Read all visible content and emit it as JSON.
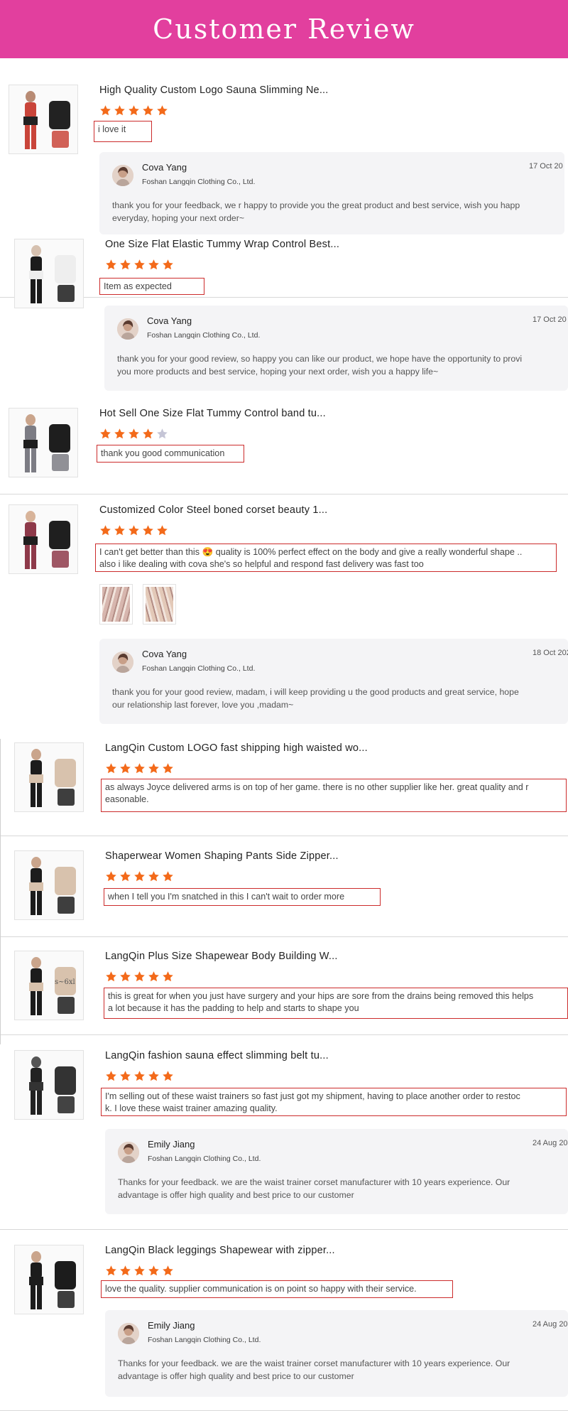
{
  "header": {
    "title": "Customer Review"
  },
  "colors": {
    "header_bg": "#e23f9e",
    "star_filled": "#f36a1a",
    "star_empty": "#c5c5d6",
    "comment_border": "#cc2b2b"
  },
  "reviews": [
    {
      "title": "High Quality Custom Logo Sauna Slimming Ne...",
      "rating": 5,
      "comment": [
        "i love it"
      ],
      "reply": {
        "name": "Cova Yang",
        "company": "Foshan Langqin Clothing Co., Ltd.",
        "date": "17 Oct 20",
        "text": [
          "thank you for your feedback, we r happy to provide you the great product and best service, wish you happ",
          "everyday, hoping your next order~"
        ]
      }
    },
    {
      "title": "One Size Flat Elastic Tummy Wrap Control Best...",
      "rating": 5,
      "comment": [
        "Item as expected"
      ],
      "reply": {
        "name": "Cova Yang",
        "company": "Foshan Langqin Clothing Co., Ltd.",
        "date": "17 Oct 20",
        "text": [
          "thank you for your good review, so happy you can like our product, we hope have the opportunity to provi",
          "you more products and best service, hoping your next order, wish you a happy life~"
        ]
      }
    },
    {
      "title": "Hot Sell One Size Flat Tummy Control band tu...",
      "rating": 4,
      "comment": [
        "thank you good communication"
      ]
    },
    {
      "title": "Customized Color Steel boned corset beauty 1...",
      "rating": 5,
      "comment": [
        "I can't get better than this 😍 quality is 100% perfect effect on the body and give a really wonderful shape ..",
        "also i like dealing with cova she's so helpful and respond fast delivery was fast too"
      ],
      "reply": {
        "name": "Cova Yang",
        "company": "Foshan Langqin Clothing Co., Ltd.",
        "date": "18 Oct 202",
        "text": [
          "thank you for your good review, madam, i will keep providing u the good products and great service, hope",
          "our relationship last forever, love you ,madam~"
        ]
      }
    },
    {
      "title": "LangQin Custom LOGO fast shipping high waisted wo...",
      "rating": 5,
      "comment": [
        "as always Joyce delivered arms is on top of her game. there is no other supplier like her. great quality and r",
        "easonable."
      ]
    },
    {
      "title": "Shaperwear Women Shaping Pants Side Zipper...",
      "rating": 5,
      "comment": [
        "when I tell you I'm snatched in this I can't wait to order more"
      ]
    },
    {
      "title": "LangQin Plus Size Shapewear Body Building W...",
      "rating": 5,
      "comment": [
        "this is great for when you just have surgery and your hips are sore from the drains being removed this helps",
        "a lot because it has the padding to help and starts to shape you"
      ],
      "thumb_text": "s~6xl"
    },
    {
      "title": "LangQin fashion sauna effect slimming belt tu...",
      "rating": 5,
      "comment": [
        "I'm selling out of these waist trainers so fast just got my shipment, having to place another order to restoc",
        "k. I love these waist trainer amazing quality."
      ],
      "reply": {
        "name": "Emily Jiang",
        "company": "Foshan Langqin Clothing Co., Ltd.",
        "date": "24 Aug 20",
        "text": [
          "Thanks for your feedback. we are the waist trainer corset manufacturer with 10 years experience. Our",
          "advantage is offer high quality and best price to our customer"
        ]
      }
    },
    {
      "title": "LangQin Black leggings Shapewear with zipper...",
      "rating": 5,
      "comment": [
        "love the quality. supplier communication is on point so happy with their service."
      ],
      "reply": {
        "name": "Emily Jiang",
        "company": "Foshan Langqin Clothing Co., Ltd.",
        "date": "24 Aug 20",
        "text": [
          "Thanks for your feedback. we are the waist trainer corset manufacturer with 10 years experience. Our",
          "advantage is offer high quality and best price to our customer"
        ]
      }
    }
  ]
}
